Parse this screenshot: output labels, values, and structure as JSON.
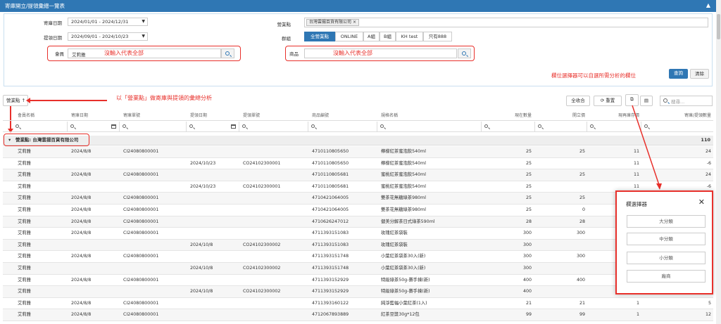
{
  "title": "寄庫開立/提領彙總一覽表",
  "filter": {
    "stock_date_label": "寄庫日期",
    "stock_date_value": "2024/01/01 - 2024/12/31",
    "pickup_date_label": "提領日期",
    "pickup_date_value": "2024/09/01 - 2024/10/23",
    "member_label": "會員",
    "member_value": "艾莉雅",
    "member_note": "沒輸入代表全部",
    "store_label": "營業點",
    "store_tag": "台灣雲揚百貨有限公司",
    "group_label": "群組",
    "groups": [
      "全營業點",
      "ONLINE",
      "A組",
      "B組",
      "KH test",
      "只有888"
    ],
    "product_label": "商品",
    "product_note": "沒輸入代表全部",
    "picker_note": "欄位選擇器可以自選所需分析的欄位",
    "query_button": "查詢",
    "clear_button": "清除"
  },
  "toolbar": {
    "group_by_chip": "營業點",
    "group_note": "以「營業點」做寄庫與提領的彙總分析",
    "collapse_all": "全收合",
    "reset": "重置",
    "search_placeholder": "搜尋..."
  },
  "table": {
    "columns": [
      "會員名稱",
      "寄庫日期",
      "寄庫單號",
      "提領日期",
      "提領單號",
      "商品編號",
      "規格名稱",
      "現在數量",
      "開立價",
      "現再庫存價",
      "寄庫/提領數量"
    ],
    "group_row": {
      "label": "營業點: 台灣雲揚百貨有限公司",
      "total": "110"
    },
    "rows": [
      [
        "艾莉雅",
        "2024/8/8",
        "CI24080800001",
        "",
        "",
        "4710110805650",
        "檸檬紅茶蜜泡飲540ml",
        "25",
        "25",
        "11",
        "24"
      ],
      [
        "艾莉雅",
        "",
        "",
        "2024/10/23",
        "CO24102300001",
        "4710110805650",
        "檸檬紅茶蜜泡飲540ml",
        "25",
        "",
        "11",
        "-6"
      ],
      [
        "艾莉雅",
        "2024/8/8",
        "CI24080800001",
        "",
        "",
        "4710110805681",
        "蜜桃紅茶蜜泡飲540ml",
        "25",
        "25",
        "11",
        "24"
      ],
      [
        "艾莉雅",
        "",
        "",
        "2024/10/23",
        "CO24102300001",
        "4710110805681",
        "蜜桃紅茶蜜泡飲540ml",
        "25",
        "",
        "11",
        "-6"
      ],
      [
        "艾莉雅",
        "2024/8/8",
        "CI24080800001",
        "",
        "",
        "4710421064005",
        "雙茶花無糖綠茶980ml",
        "25",
        "25",
        "",
        ""
      ],
      [
        "艾莉雅",
        "2024/8/8",
        "CI24080800001",
        "",
        "",
        "4710421064005",
        "雙茶花無糖綠茶980ml",
        "25",
        "0",
        "",
        ""
      ],
      [
        "艾莉雅",
        "2024/8/8",
        "CI24080800001",
        "",
        "",
        "4710626247012",
        "健美分解茶日式綠茶590ml",
        "28",
        "28",
        "",
        ""
      ],
      [
        "艾莉雅",
        "2024/8/8",
        "CI24080800001",
        "",
        "",
        "4711393151083",
        "玫瑰紅茶袋裝",
        "300",
        "300",
        "",
        ""
      ],
      [
        "艾莉雅",
        "",
        "",
        "2024/10/8",
        "CO24102300002",
        "4711393151083",
        "玫瑰紅茶袋裝",
        "300",
        "",
        "",
        ""
      ],
      [
        "艾莉雅",
        "2024/8/8",
        "CI24080800001",
        "",
        "",
        "4711393151748",
        "小葉紅茶袋茶30入(新)",
        "300",
        "300",
        "",
        ""
      ],
      [
        "艾莉雅",
        "",
        "",
        "2024/10/8",
        "CO24102300002",
        "4711393151748",
        "小葉紅茶袋茶30入(新)",
        "300",
        "",
        "",
        ""
      ],
      [
        "艾莉雅",
        "2024/8/8",
        "CI24080800001",
        "",
        "",
        "4711393152929",
        "特級綠茶50g-賽手揀(新)",
        "400",
        "400",
        "",
        ""
      ],
      [
        "艾莉雅",
        "",
        "",
        "2024/10/8",
        "CO24102300002",
        "4711393152929",
        "特級綠茶50g-賽手揀(新)",
        "400",
        "",
        "",
        ""
      ],
      [
        "艾莉雅",
        "2024/8/8",
        "CI24080800001",
        "",
        "",
        "4711393160122",
        "純淨藍幅小葉紅茶(1入)",
        "21",
        "21",
        "1",
        "5"
      ],
      [
        "艾莉雅",
        "2024/8/8",
        "CI24080800001",
        "",
        "",
        "4712067893889",
        "紅茶豆漿30g*12包",
        "99",
        "99",
        "1",
        "12"
      ]
    ]
  },
  "column_picker": {
    "title": "欄選擇器",
    "items": [
      "大分類",
      "中分類",
      "小分類",
      "廠商"
    ]
  }
}
